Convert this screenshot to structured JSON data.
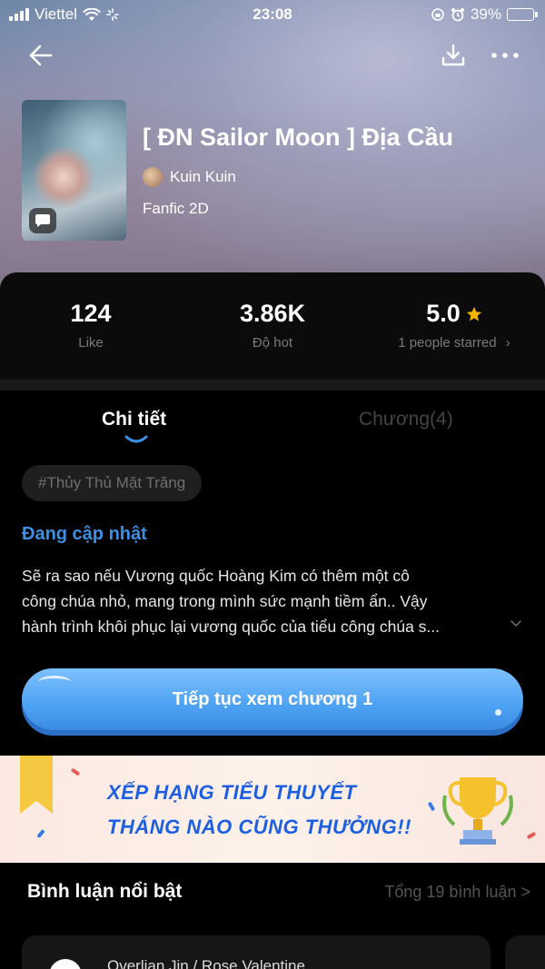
{
  "status_bar": {
    "carrier": "Viettel",
    "time": "23:08",
    "battery_text": "39%",
    "battery_level": 0.39
  },
  "book": {
    "title": "[ ĐN Sailor Moon ] Địa Cầu",
    "author": "Kuin Kuin",
    "genre": "Fanfic 2D"
  },
  "stats": {
    "likes_value": "124",
    "likes_label": "Like",
    "hot_value": "3.86K",
    "hot_label": "Độ hot",
    "rating_value": "5.0",
    "rating_label": "1 people starred",
    "rating_chevron": "›"
  },
  "tabs": {
    "details": "Chi tiết",
    "chapters": "Chương(4)"
  },
  "tag": "#Thủy Thủ Mặt Trăng",
  "update_status": "Đang cập nhật",
  "description": {
    "line1": "Sẽ ra sao nếu Vương quốc Hoàng Kim có thêm một cô",
    "line2": "công chúa nhỏ, mang trong mình sức mạnh tiềm ẩn.. Vậy",
    "line3": "hành trình  khôi phục lại vương quốc của tiểu công chúa s..."
  },
  "cta_label": "Tiếp tục xem chương 1",
  "banner": {
    "line1": "XẾP HẠNG TIỂU THUYẾT",
    "line2": "THÁNG NÀO CŨNG THƯỞNG!!"
  },
  "comments": {
    "title": "Bình luận nổi bật",
    "total": "Tổng 19 bình luận >",
    "first_user": "Overlian Jin / Rose Valentine"
  },
  "colors": {
    "accent_blue": "#3d8fe6",
    "star": "#f5b400",
    "battery_green": "#6ad04b"
  }
}
